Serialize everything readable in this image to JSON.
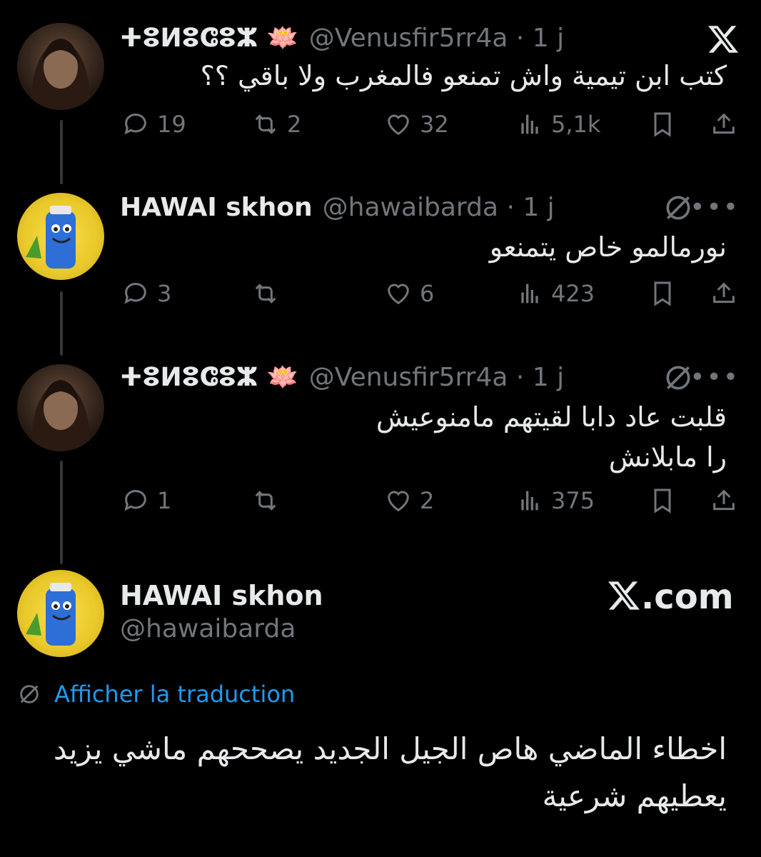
{
  "thread": [
    {
      "avatar": "venus-avatar",
      "display_name": "ⵜⵓⵍⵓⵛⵓⵣ 🪷",
      "handle": "@Venusfir5rr4a · 1 j",
      "lines": [
        "كتب ابن تيمية واش تمنعو فالمغرب ولا باقي ؟؟"
      ],
      "replies": "19",
      "reposts": "2",
      "likes": "32",
      "views": "5,1k"
    },
    {
      "avatar": "hawai-avatar",
      "display_name": "HAWAI skhon",
      "handle": "@hawaibarda · 1 j",
      "lines": [
        "نورمالمو خاص يتمنعو"
      ],
      "replies": "3",
      "reposts": "",
      "likes": "6",
      "views": "423"
    },
    {
      "avatar": "venus-avatar",
      "display_name": "ⵜⵓⵍⵓⵛⵓⵣ 🪷",
      "handle": "@Venusfir5rr4a · 1 j",
      "lines": [
        "قلبت عاد دابا لقيتهم مامنوعيش",
        "را مابلانش"
      ],
      "replies": "1",
      "reposts": "",
      "likes": "2",
      "views": "375"
    }
  ],
  "main_post": {
    "display_name": "HAWAI skhon",
    "handle": "@hawaibarda",
    "brand": ".com",
    "translate_label": "Afficher la traduction",
    "lines": [
      "اخطاء الماضي هاص الجيل الجديد يصححهم ماشي يزيد",
      "يعطيهم شرعية"
    ]
  },
  "colors": {
    "background": "#000000",
    "text": "#e7e9ea",
    "muted": "#71767b",
    "link": "#1d9bf0",
    "thread_line": "#333639"
  }
}
